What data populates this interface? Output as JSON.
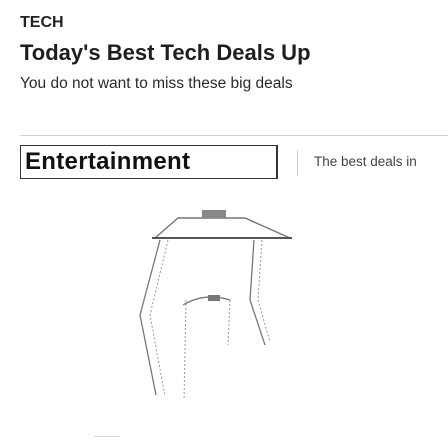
{
  "article": {
    "category": "TECH",
    "headline": "Today's Best Tech Deals Up",
    "subheadline": "You do not want to miss these big deals"
  },
  "related": {
    "tag_label": "Entertainment",
    "teaser": "The best deals in"
  },
  "colors": {
    "text": "#222222",
    "divider": "#cfcfcf",
    "illustration_stroke": "#888888"
  },
  "icons": [
    "chair-illustration"
  ]
}
